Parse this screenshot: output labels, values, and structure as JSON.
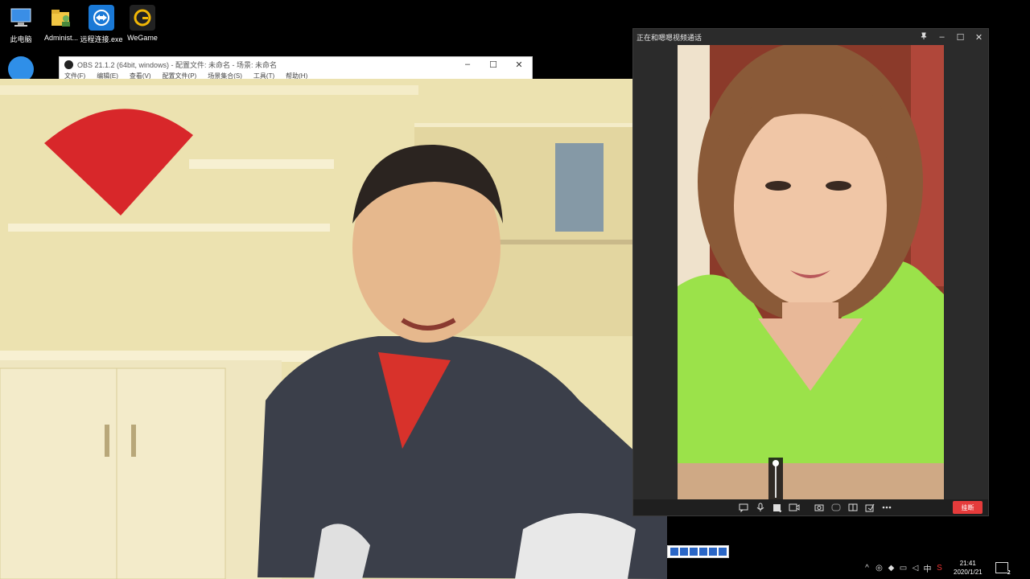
{
  "desktop": {
    "icons": [
      {
        "label": "此电脑",
        "icon": "computer-icon"
      },
      {
        "label": "Administ...",
        "icon": "user-folder-icon"
      },
      {
        "label": "远程连接.exe",
        "icon": "teamviewer-icon"
      },
      {
        "label": "WeGame",
        "icon": "wegame-icon"
      }
    ]
  },
  "obs": {
    "title": "OBS 21.1.2 (64bit, windows) - 配置文件: 未命名 - 场景: 未命名",
    "menu": [
      "文件(F)",
      "编辑(E)",
      "查看(V)",
      "配置文件(P)",
      "场景集合(S)",
      "工具(T)",
      "帮助(H)"
    ],
    "minimize": "–",
    "maximize": "☐",
    "close": "✕"
  },
  "call": {
    "title": "正在和嗯嗯视频通话",
    "pin": "📌",
    "minimize": "–",
    "maximize": "☐",
    "close": "✕",
    "hangup_label": "挂断",
    "volume_level": 1.0,
    "toolbar_icons": [
      "chat-icon",
      "microphone-icon",
      "speaker-icon",
      "camera-icon",
      "screenshot-icon",
      "effects-icon",
      "layout-icon",
      "whiteboard-icon",
      "more-icon"
    ]
  },
  "taskbar": {
    "time": "21:41",
    "date": "2020/1/21",
    "ime_label": "中",
    "notifications_count": "2"
  },
  "colors": {
    "hangup": "#e53b3b",
    "call_bg": "#2b2b2b",
    "remote_shirt": "#9be24a"
  }
}
